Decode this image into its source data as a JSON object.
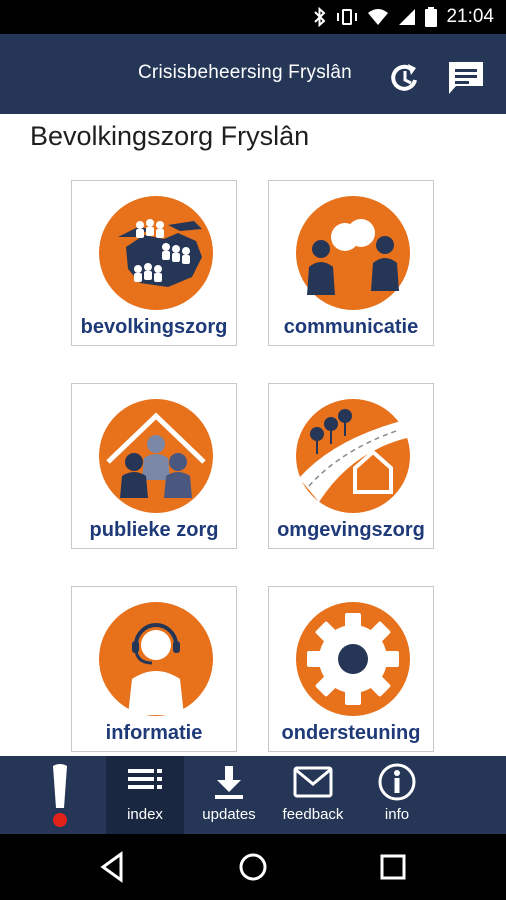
{
  "status_bar": {
    "time": "21:04"
  },
  "app_bar": {
    "title": "Crisisbeheersing Fryslân",
    "icons": [
      "refresh-icon",
      "chat-icon"
    ]
  },
  "page": {
    "title": "Bevolkingszorg Fryslân"
  },
  "tiles": [
    {
      "label": "bevolkingszorg",
      "icon": "map-people-icon"
    },
    {
      "label": "communicatie",
      "icon": "conversation-icon"
    },
    {
      "label": "publieke zorg",
      "icon": "shelter-icon"
    },
    {
      "label": "omgevingszorg",
      "icon": "environment-icon"
    },
    {
      "label": "informatie",
      "icon": "headset-icon"
    },
    {
      "label": "ondersteuning",
      "icon": "gear-icon"
    }
  ],
  "bottom_nav": {
    "alert_icon": "exclamation-icon",
    "items": [
      {
        "label": "index",
        "icon": "list-icon",
        "active": true
      },
      {
        "label": "updates",
        "icon": "download-icon"
      },
      {
        "label": "feedback",
        "icon": "mail-icon"
      },
      {
        "label": "info",
        "icon": "info-icon"
      }
    ]
  },
  "colors": {
    "primary": "#253656",
    "accent": "#e8711c",
    "label": "#1f3a78",
    "alert_dot": "#e2231a"
  }
}
